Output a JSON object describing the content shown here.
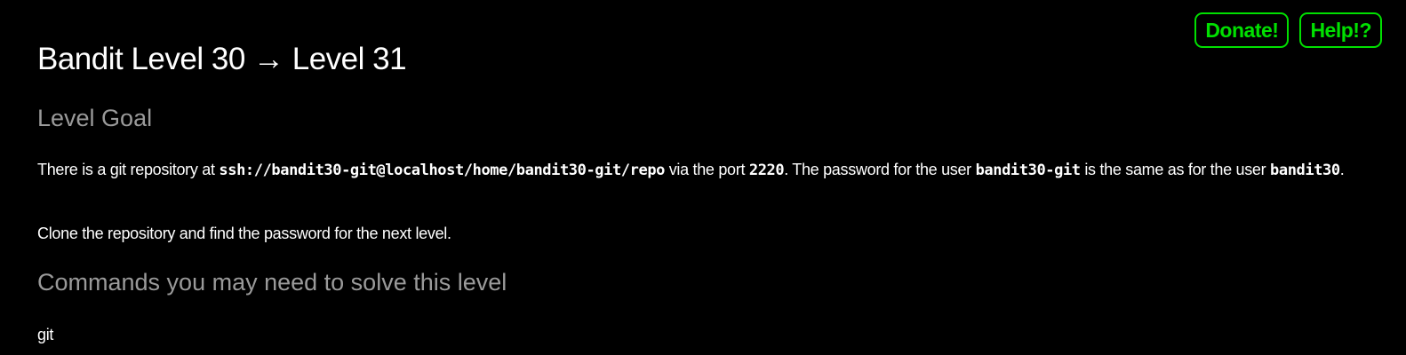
{
  "buttons": {
    "donate": "Donate!",
    "help": "Help!?"
  },
  "page": {
    "title": "Bandit Level 30 → Level 31"
  },
  "goal": {
    "heading": "Level Goal",
    "p1_t1": "There is a git repository at ",
    "p1_code1": "ssh://bandit30-git@localhost/home/bandit30-git/repo",
    "p1_t2": " via the port ",
    "p1_code2": "2220",
    "p1_t3": ". The password for the user ",
    "p1_code3": "bandit30-git",
    "p1_t4": " is the same as for the user ",
    "p1_code4": "bandit30",
    "p1_t5": ".",
    "p2": "Clone the repository and find the password for the next level."
  },
  "commands": {
    "heading": "Commands you may need to solve this level",
    "list": "git"
  },
  "colors": {
    "accent": "#00e000",
    "background": "#000000",
    "heading_secondary": "#9a9a9a"
  }
}
